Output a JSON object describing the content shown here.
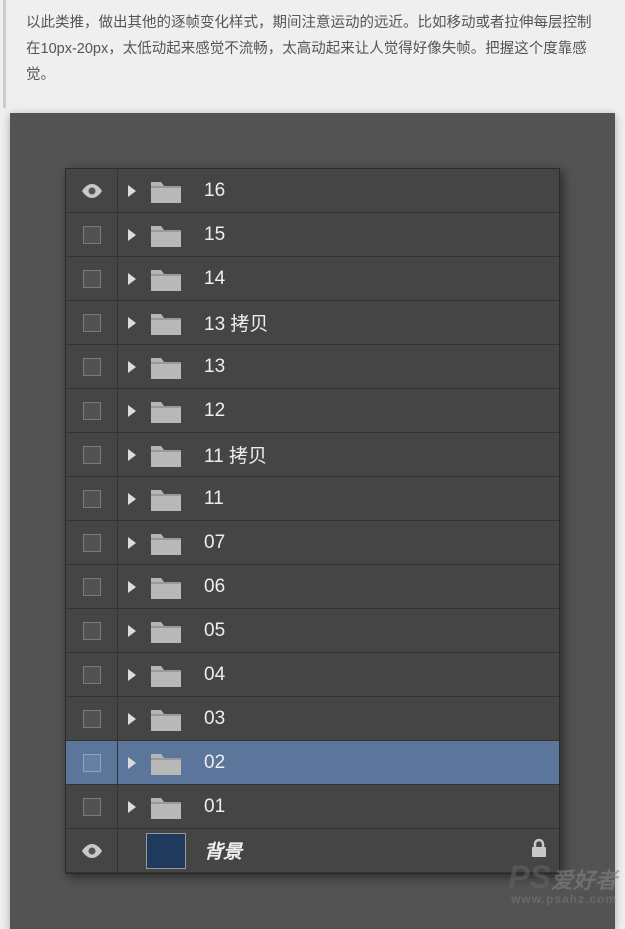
{
  "article": {
    "text": "以此类推，做出其他的逐帧变化样式，期间注意运动的远近。比如移动或者拉伸每层控制在10px-20px，太低动起来感觉不流畅，太高动起来让人觉得好像失帧。把握这个度靠感觉。"
  },
  "layers": [
    {
      "visible": true,
      "type": "folder",
      "name": "16",
      "selected": false
    },
    {
      "visible": false,
      "type": "folder",
      "name": "15",
      "selected": false
    },
    {
      "visible": false,
      "type": "folder",
      "name": "14",
      "selected": false
    },
    {
      "visible": false,
      "type": "folder",
      "name": "13 拷贝",
      "selected": false
    },
    {
      "visible": false,
      "type": "folder",
      "name": "13",
      "selected": false
    },
    {
      "visible": false,
      "type": "folder",
      "name": "12",
      "selected": false
    },
    {
      "visible": false,
      "type": "folder",
      "name": "11 拷贝",
      "selected": false
    },
    {
      "visible": false,
      "type": "folder",
      "name": "11",
      "selected": false
    },
    {
      "visible": false,
      "type": "folder",
      "name": "07",
      "selected": false
    },
    {
      "visible": false,
      "type": "folder",
      "name": "06",
      "selected": false
    },
    {
      "visible": false,
      "type": "folder",
      "name": "05",
      "selected": false
    },
    {
      "visible": false,
      "type": "folder",
      "name": "04",
      "selected": false
    },
    {
      "visible": false,
      "type": "folder",
      "name": "03",
      "selected": false
    },
    {
      "visible": false,
      "type": "folder",
      "name": "02",
      "selected": true
    },
    {
      "visible": false,
      "type": "folder",
      "name": "01",
      "selected": false
    },
    {
      "visible": true,
      "type": "background",
      "name": "背景",
      "locked": true,
      "selected": false
    }
  ],
  "watermark": {
    "ps": "PS",
    "cn": "爱好者",
    "sub": "www.psahz.com"
  }
}
